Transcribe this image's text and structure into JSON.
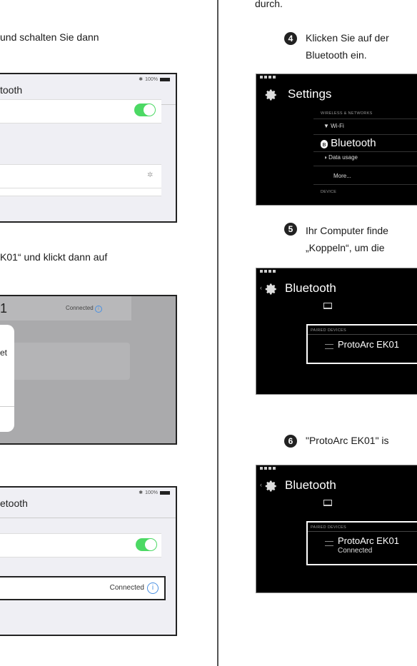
{
  "left": {
    "step3_text_tail": "und schalten Sie dann",
    "panel1": {
      "title_fragment": "tooth",
      "status": "100%"
    },
    "step_text2": "K01“ und klickt dann auf",
    "panel2": {
      "title_fragment": "1",
      "connected": "Connected",
      "dialog_fragment": "et"
    },
    "panel3": {
      "title_fragment": "etooth",
      "status": "100%",
      "connected": "Connected"
    }
  },
  "right": {
    "top_text": "durch.",
    "step4": {
      "number": "4",
      "line1": "Klicken Sie auf der",
      "line2": "Bluetooth ein."
    },
    "settings_panel": {
      "title": "Settings",
      "section_wireless": "WIRELESS & NETWORKS",
      "wifi": "Wi-Fi",
      "bluetooth": "Bluetooth",
      "data_usage": "Data usage",
      "more": "More...",
      "section_device": "DEVICE"
    },
    "step5": {
      "number": "5",
      "line1": "Ihr Computer finde",
      "line2": "„Koppeln“, um die"
    },
    "bt_panel1": {
      "title": "Bluetooth",
      "section": "PAIRED DEVICES",
      "device": "ProtoArc EK01"
    },
    "step6": {
      "number": "6",
      "text": "\"ProtoArc EK01\" is"
    },
    "bt_panel2": {
      "title": "Bluetooth",
      "section": "PAIRED DEVICES",
      "device": "ProtoArc EK01",
      "status": "Connected"
    }
  }
}
